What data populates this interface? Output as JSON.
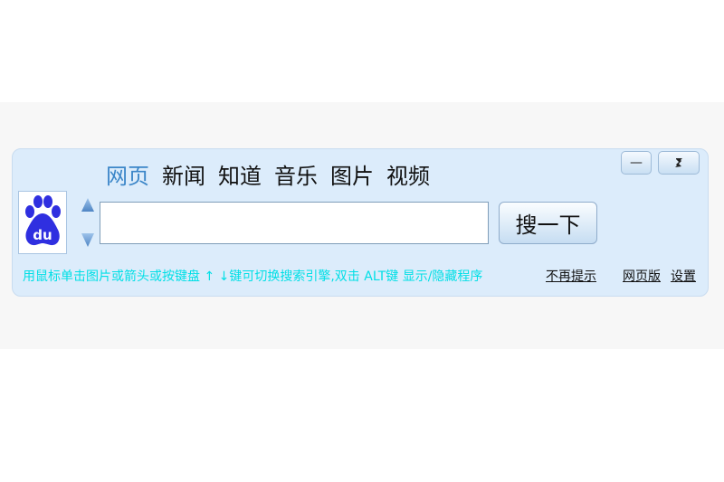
{
  "tabs": [
    {
      "label": "网页",
      "active": true
    },
    {
      "label": "新闻",
      "active": false
    },
    {
      "label": "知道",
      "active": false
    },
    {
      "label": "音乐",
      "active": false
    },
    {
      "label": "图片",
      "active": false
    },
    {
      "label": "视频",
      "active": false
    }
  ],
  "window_controls": {
    "minimize_label": "—",
    "restore_label": "ⅰ"
  },
  "logo": {
    "text": "du",
    "icon": "baidu-paw-icon"
  },
  "search": {
    "value": "",
    "button_label": "搜一下"
  },
  "footer": {
    "hint": "用鼠标单击图片或箭头或按键盘 ↑ ↓键可切换搜索引擎,双击 ALT键 显示/隐藏程序",
    "dont_show_again": "不再提示",
    "web_version": "网页版",
    "settings": "设置"
  },
  "colors": {
    "panel_background": "#dcecfb",
    "active_tab": "#3b86c8",
    "hint_text": "#00dfe6",
    "logo_blue": "#2f2fe0"
  }
}
